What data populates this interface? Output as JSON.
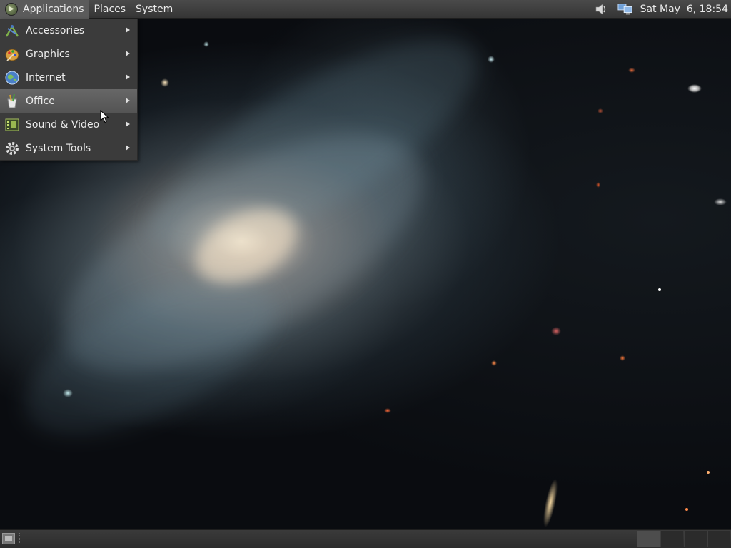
{
  "top_panel": {
    "menus": [
      {
        "label": "Applications",
        "active": true
      },
      {
        "label": "Places",
        "active": false
      },
      {
        "label": "System",
        "active": false
      }
    ],
    "tray_icons": [
      "speaker-icon",
      "network-icon"
    ],
    "clock": "Sat May  6, 18:54"
  },
  "app_menu": {
    "items": [
      {
        "label": "Accessories",
        "icon": "accessories-icon",
        "highlighted": false
      },
      {
        "label": "Graphics",
        "icon": "graphics-icon",
        "highlighted": false
      },
      {
        "label": "Internet",
        "icon": "internet-icon",
        "highlighted": false
      },
      {
        "label": "Office",
        "icon": "office-icon",
        "highlighted": true
      },
      {
        "label": "Sound & Video",
        "icon": "sound-video-icon",
        "highlighted": false
      },
      {
        "label": "System Tools",
        "icon": "system-tools-icon",
        "highlighted": false
      }
    ]
  },
  "bottom_panel": {
    "show_desktop_icon": "show-desktop-icon",
    "workspaces": 4,
    "active_workspace": 1
  },
  "colors": {
    "panel": "#3d3d3d",
    "menu_bg": "#3b3b3b",
    "menu_highlight": "#5e5e5e",
    "text": "#ececec"
  }
}
